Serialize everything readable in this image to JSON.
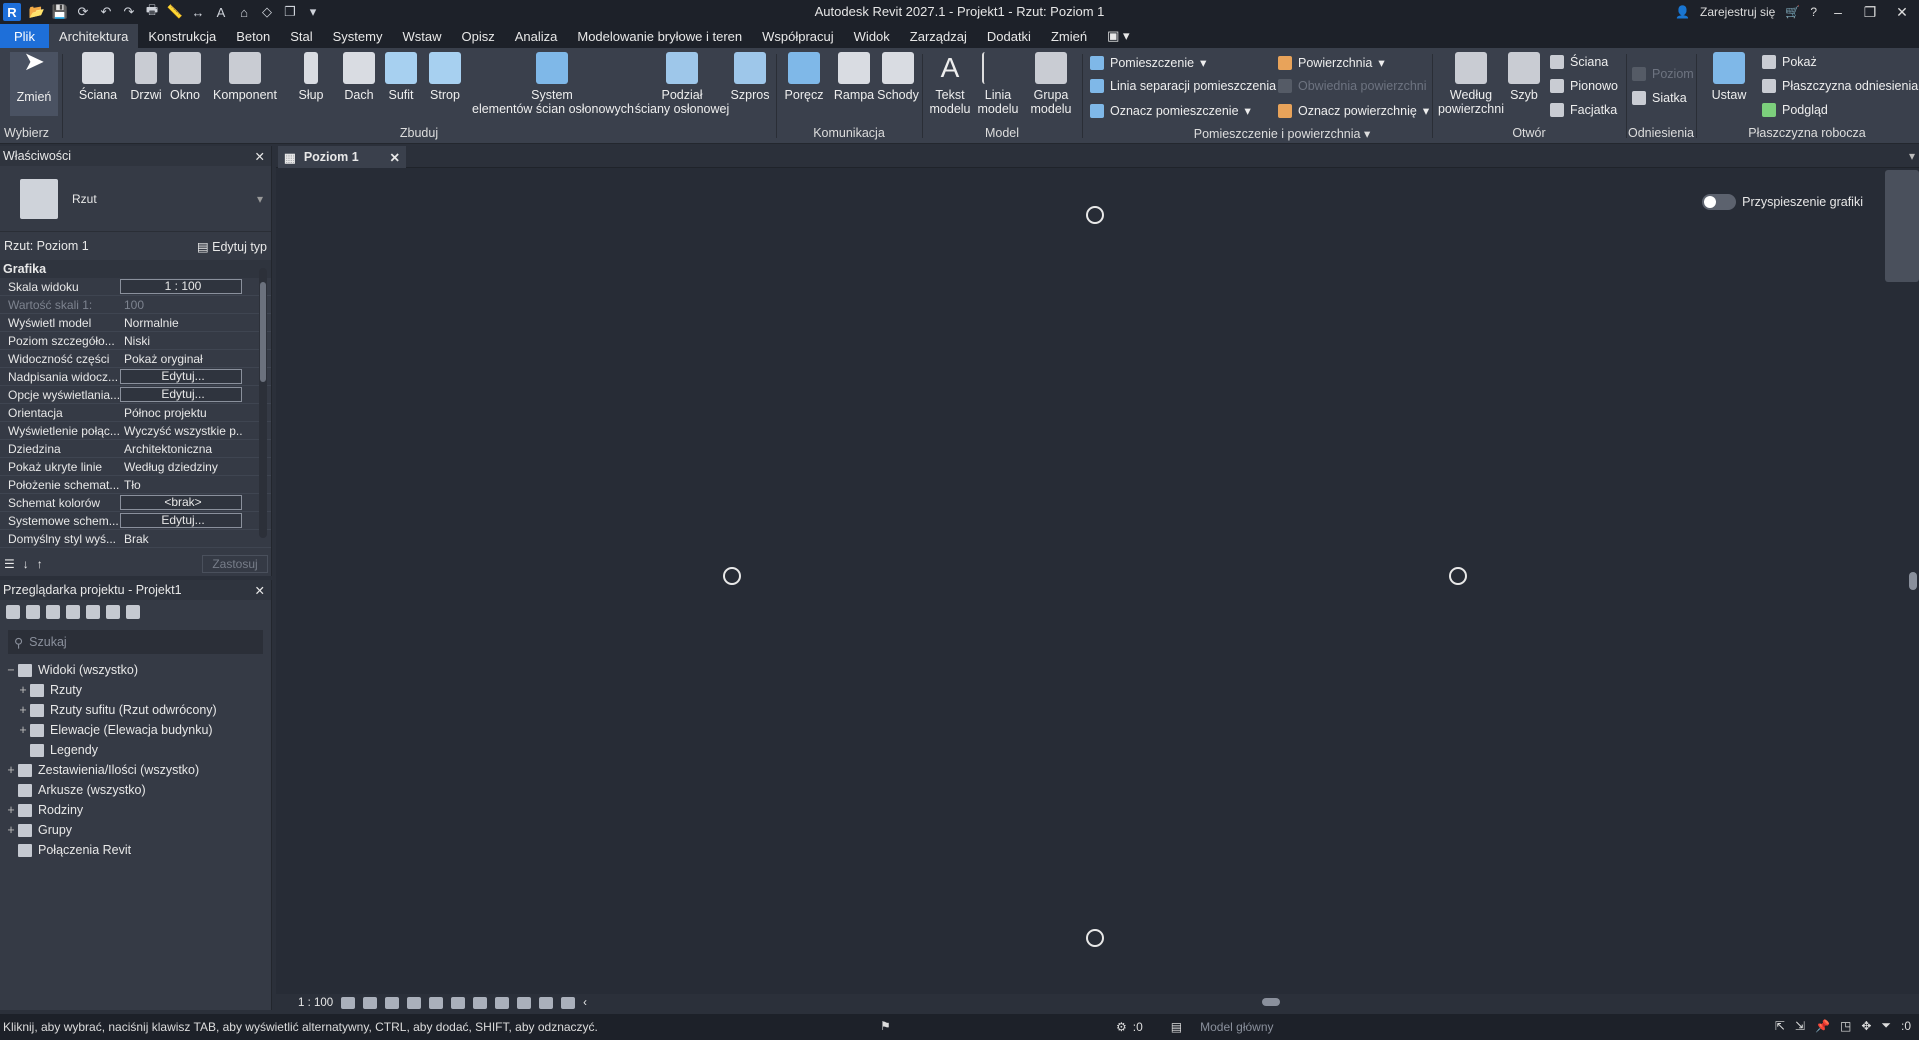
{
  "app": {
    "title": "Autodesk Revit 2027.1 - Projekt1 - Rzut: Poziom 1",
    "logo": "R",
    "signin": "Zarejestruj się"
  },
  "menu": [
    "Plik",
    "Architektura",
    "Konstrukcja",
    "Beton",
    "Stal",
    "Systemy",
    "Wstaw",
    "Opisz",
    "Analiza",
    "Modelowanie bryłowe i teren",
    "Współpracuj",
    "Widok",
    "Zarządzaj",
    "Dodatki",
    "Zmień"
  ],
  "ribbon": {
    "select": {
      "modify": "Zmień",
      "group": "Wybierz"
    },
    "build": {
      "buttons": [
        "Ściana",
        "Drzwi",
        "Okno",
        "Komponent",
        "Słup",
        "Dach",
        "Sufit",
        "Strop",
        "System\nelementów ścian osłonowych",
        "Podział\nściany osłonowej",
        "Szpros"
      ],
      "group": "Zbuduj"
    },
    "circulation": {
      "buttons": [
        "Poręcz",
        "Rampa",
        "Schody"
      ],
      "group": "Komunikacja"
    },
    "model": {
      "buttons": [
        "Tekst\nmodelu",
        "Linia\nmodelu",
        "Grupa\nmodelu"
      ],
      "group": "Model"
    },
    "room": {
      "items": [
        "Pomieszczenie",
        "Linia separacji pomieszczenia",
        "Oznacz pomieszczenie",
        "Powierzchnia",
        "Obwiednia powierzchni",
        "Oznacz powierzchnię"
      ],
      "group": "Pomieszczenie i powierzchnia"
    },
    "opening": {
      "buttons": [
        "Według\npowierzchni",
        "Szyb"
      ],
      "items": [
        "Ściana",
        "Pionowo",
        "Facjatka"
      ],
      "group": "Otwór"
    },
    "datum": {
      "items": [
        "Poziom",
        "Siatka"
      ],
      "group": "Odniesienia"
    },
    "workplane": {
      "button": "Ustaw",
      "items": [
        "Pokaż",
        "Płaszczyzna odniesienia",
        "Podgląd"
      ],
      "group": "Płaszczyzna robocza"
    }
  },
  "properties": {
    "title": "Właściwości",
    "type": "Rzut",
    "selector": "Rzut: Poziom 1",
    "edit_type": "Edytuj typ",
    "group": "Grafika",
    "rows": [
      [
        "Skala widoku",
        "1 : 100"
      ],
      [
        "Wartość skali  1:",
        "100"
      ],
      [
        "Wyświetl model",
        "Normalnie"
      ],
      [
        "Poziom szczegóło...",
        "Niski"
      ],
      [
        "Widoczność części",
        "Pokaż oryginał"
      ],
      [
        "Nadpisania widocz...",
        "Edytuj..."
      ],
      [
        "Opcje wyświetlania...",
        "Edytuj..."
      ],
      [
        "Orientacja",
        "Północ projektu"
      ],
      [
        "Wyświetlenie połąc...",
        "Wyczyść wszystkie p..."
      ],
      [
        "Dziedzina",
        "Architektoniczna"
      ],
      [
        "Pokaż ukryte linie",
        "Według dziedziny"
      ],
      [
        "Położenie schemat...",
        "Tło"
      ],
      [
        "Schemat kolorów",
        "<brak>"
      ],
      [
        "Systemowe schem...",
        "Edytuj..."
      ],
      [
        "Domyślny styl wyś...",
        "Brak"
      ]
    ],
    "apply": "Zastosuj"
  },
  "browser": {
    "title": "Przeglądarka projektu - Projekt1",
    "search_placeholder": "Szukaj",
    "tree": [
      {
        "label": "Widoki (wszystko)",
        "pm": "−",
        "lvl": 0
      },
      {
        "label": "Rzuty",
        "pm": "+",
        "lvl": 1
      },
      {
        "label": "Rzuty sufitu (Rzut odwrócony)",
        "pm": "+",
        "lvl": 1
      },
      {
        "label": "Elewacje (Elewacja budynku)",
        "pm": "+",
        "lvl": 1
      },
      {
        "label": "Legendy",
        "pm": "",
        "lvl": 1
      },
      {
        "label": "Zestawienia/Ilości (wszystko)",
        "pm": "+",
        "lvl": 0
      },
      {
        "label": "Arkusze (wszystko)",
        "pm": "",
        "lvl": 0
      },
      {
        "label": "Rodziny",
        "pm": "+",
        "lvl": 0
      },
      {
        "label": "Grupy",
        "pm": "+",
        "lvl": 0
      },
      {
        "label": "Połączenia Revit",
        "pm": "",
        "lvl": 0
      }
    ]
  },
  "view": {
    "tab": "Poziom 1",
    "accel": "Przyspieszenie grafiki",
    "scale": "1 : 100"
  },
  "status": {
    "hint": "Kliknij, aby wybrać, naciśnij klawisz TAB, aby wyświetlić alternatywny, CTRL, aby dodać, SHIFT, aby odznaczyć.",
    "count": ":0",
    "model": "Model główny",
    "filter": ":0"
  }
}
